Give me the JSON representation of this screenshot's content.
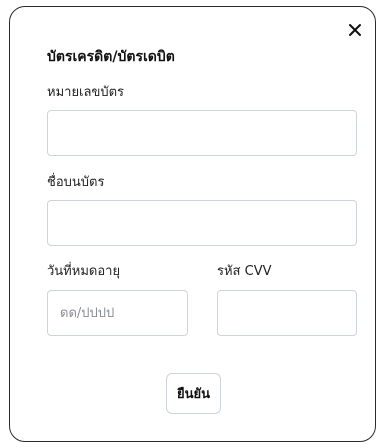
{
  "dialog": {
    "title": "บัตรเครดิต/บัตรเดบิต",
    "close_icon": "close-icon"
  },
  "form": {
    "card_number": {
      "label": "หมายเลขบัตร",
      "value": "",
      "placeholder": ""
    },
    "card_name": {
      "label": "ชื่อบนบัตร",
      "value": "",
      "placeholder": ""
    },
    "expiry": {
      "label": "วันที่หมดอายุ",
      "value": "",
      "placeholder": "ดด/ปปปป"
    },
    "cvv": {
      "label": "รหัส CVV",
      "value": "",
      "placeholder": ""
    }
  },
  "actions": {
    "confirm_label": "ยืนยัน"
  },
  "colors": {
    "border": "#2b2b2b",
    "input_border": "#cfd4da",
    "placeholder": "#8a8f95"
  }
}
